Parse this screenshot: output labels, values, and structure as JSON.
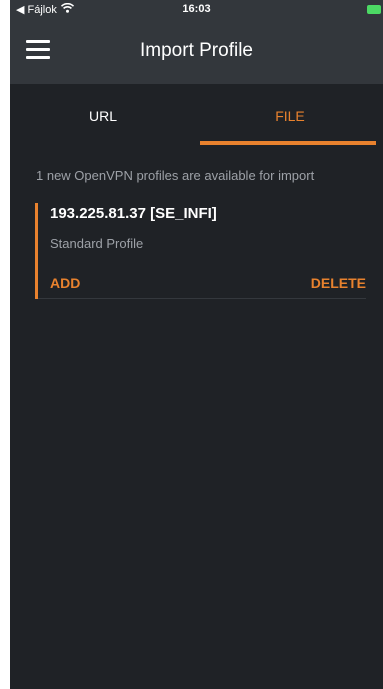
{
  "status_bar": {
    "back_label": "◀ Fájlok",
    "time": "16:03"
  },
  "header": {
    "title": "Import Profile"
  },
  "tabs": [
    {
      "label": "URL",
      "active": false
    },
    {
      "label": "FILE",
      "active": true
    }
  ],
  "info_text": "1 new OpenVPN profiles are available for import",
  "profile": {
    "title": "193.225.81.37 [SE_INFI]",
    "subtitle": "Standard Profile",
    "add_label": "ADD",
    "delete_label": "DELETE"
  },
  "colors": {
    "accent": "#e8822e",
    "background": "#1f2226",
    "header": "#33373c"
  }
}
